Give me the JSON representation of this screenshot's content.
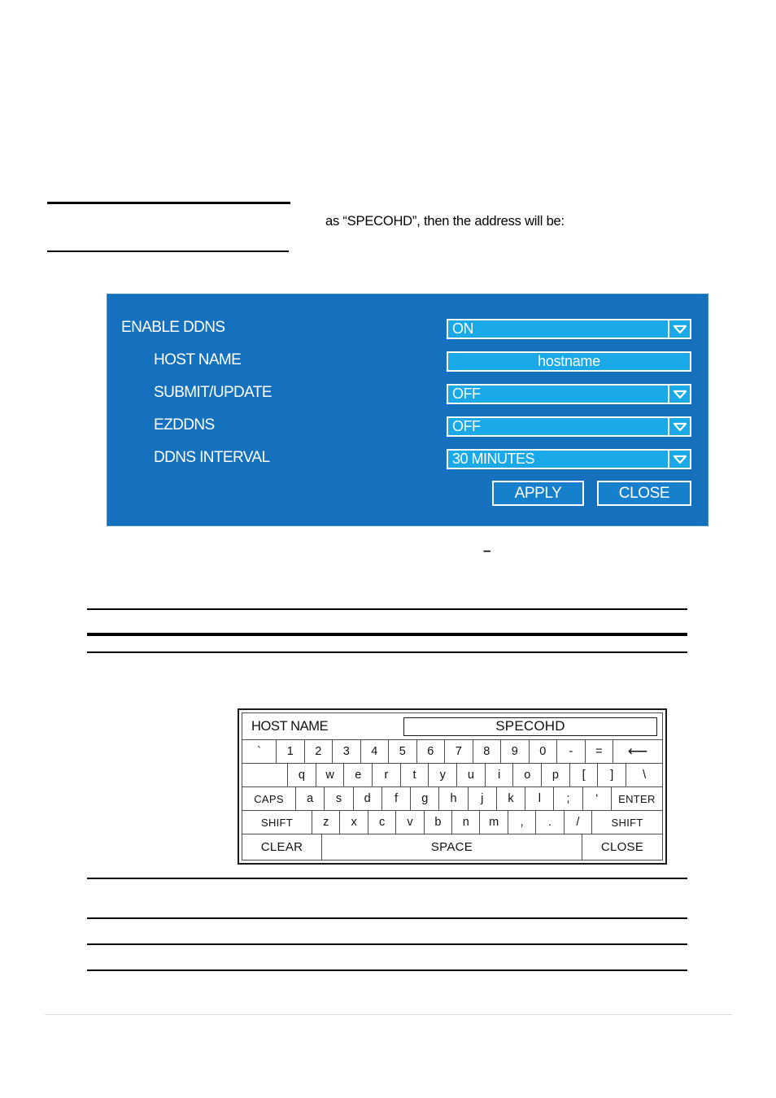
{
  "page": {
    "body_text": "as “SPECOHD”, then the address will be:",
    "stray_dash": "–"
  },
  "ddns_dialog": {
    "rows": [
      {
        "label": "ENABLE DDNS",
        "control": "dropdown",
        "value": "ON"
      },
      {
        "label": "HOST NAME",
        "control": "textfield",
        "value": "hostname"
      },
      {
        "label": "SUBMIT/UPDATE",
        "control": "dropdown",
        "value": "OFF"
      },
      {
        "label": "EZDDNS",
        "control": "dropdown",
        "value": "OFF"
      },
      {
        "label": "DDNS INTERVAL",
        "control": "dropdown",
        "value": "30 MINUTES"
      }
    ],
    "apply_label": "APPLY",
    "close_label": "CLOSE",
    "colors": {
      "dialog_background": "#1571bd",
      "control_fill": "#19a8e8",
      "control_border": "#ffffff",
      "button_fill": "#1780cd",
      "text": "#ffffff"
    }
  },
  "keyboard": {
    "host_name_label": "HOST NAME",
    "host_name_value": "SPECOHD",
    "row1": [
      "`",
      "1",
      "2",
      "3",
      "4",
      "5",
      "6",
      "7",
      "8",
      "9",
      "0",
      "-",
      "=",
      "⟵"
    ],
    "row2": [
      "",
      "q",
      "w",
      "e",
      "r",
      "t",
      "y",
      "u",
      "i",
      "o",
      "p",
      "[",
      "]",
      "\\"
    ],
    "row3": [
      "CAPS",
      "a",
      "s",
      "d",
      "f",
      "g",
      "h",
      "j",
      "k",
      "l",
      ";",
      "‘",
      "ENTER"
    ],
    "row4": [
      "SHIFT",
      "z",
      "x",
      "c",
      "v",
      "b",
      "n",
      "m",
      ",",
      ".",
      "/",
      "SHIFT"
    ],
    "row5": [
      "CLEAR",
      "SPACE",
      "CLOSE"
    ]
  }
}
